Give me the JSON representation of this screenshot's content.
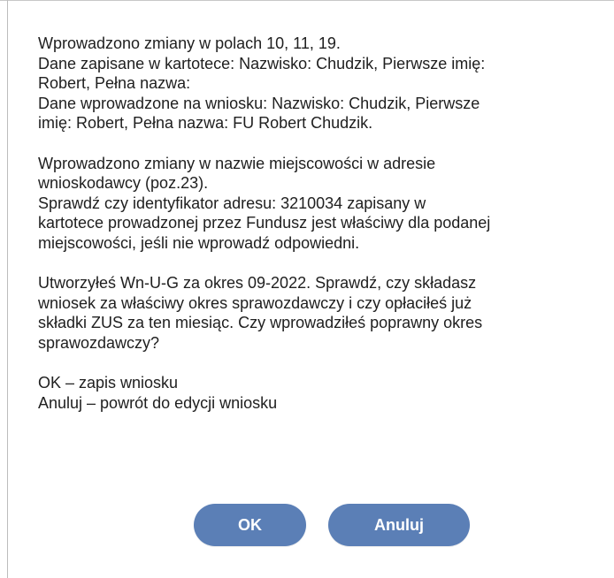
{
  "dialog": {
    "paragraphs": [
      {
        "lines": [
          "Wprowadzono zmiany w polach 10, 11, 19.",
          "Dane zapisane w kartotece: Nazwisko: Chudzik, Pierwsze imię:",
          "Robert, Pełna nazwa:",
          "Dane wprowadzone na wniosku: Nazwisko: Chudzik, Pierwsze",
          "imię: Robert, Pełna nazwa: FU Robert Chudzik."
        ]
      },
      {
        "lines": [
          "Wprowadzono zmiany w nazwie miejscowości w adresie",
          "wnioskodawcy (poz.23).",
          "Sprawdź czy identyfikator adresu: 3210034 zapisany w",
          "kartotece prowadzonej przez Fundusz jest właściwy dla podanej",
          "miejscowości, jeśli nie wprowadź odpowiedni."
        ]
      },
      {
        "lines": [
          "Utworzyłeś Wn-U-G za okres 09-2022. Sprawdź, czy składasz",
          "wniosek za właściwy okres sprawozdawczy i czy opłaciłeś już",
          "składki ZUS za ten miesiąc. Czy wprowadziłeś poprawny okres",
          "sprawozdawczy?"
        ]
      },
      {
        "lines": [
          "OK – zapis wniosku",
          "Anuluj – powrót do edycji wniosku"
        ]
      }
    ],
    "buttons": {
      "ok_label": "OK",
      "cancel_label": "Anuluj"
    }
  },
  "colors": {
    "button_bg": "#5b7fb6",
    "button_text": "#ffffff",
    "text": "#202020",
    "background": "#ffffff"
  }
}
